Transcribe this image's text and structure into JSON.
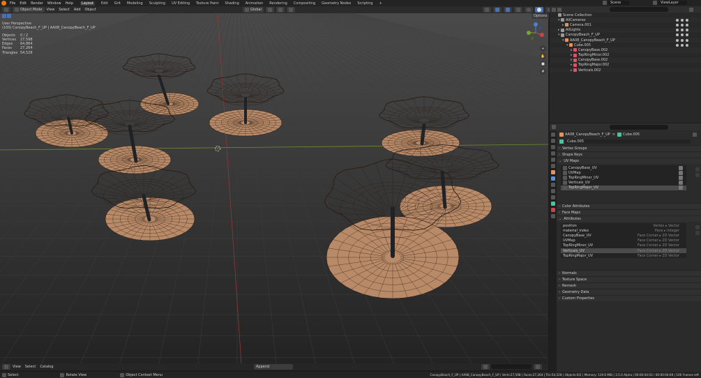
{
  "topbar": {
    "menus": [
      "File",
      "Edit",
      "Render",
      "Window",
      "Help"
    ],
    "workspaces": [
      "Layout",
      "Edit",
      "Grit",
      "Modeling",
      "Sculpting",
      "UV Editing",
      "Texture Paint",
      "Shading",
      "Animation",
      "Rendering",
      "Compositing",
      "Geometry Nodes",
      "Scripting"
    ],
    "active_workspace": "Layout",
    "plus": "+",
    "scene_label": "Scene",
    "viewlayer_label": "ViewLayer"
  },
  "viewport_header": {
    "mode": "Object Mode",
    "menus": [
      "View",
      "Select",
      "Add",
      "Object"
    ],
    "orientation": "Global",
    "options": "Options"
  },
  "viewport_info": {
    "view_name": "User Perspective",
    "context": "(100) CanopyBeach_F_UP | AA08_CanopyBeach_F_UP",
    "stats": [
      {
        "label": "Objects",
        "value": "0 / 2"
      },
      {
        "label": "Vertices",
        "value": "27,598"
      },
      {
        "label": "Edges",
        "value": "64,864"
      },
      {
        "label": "Faces",
        "value": "27,264"
      },
      {
        "label": "Triangles",
        "value": "54,528"
      }
    ]
  },
  "gizmo": {
    "x": "X",
    "y": "Y",
    "z": "Z"
  },
  "viewport_footer": {
    "menus": [
      "View",
      "Select",
      "Catalog"
    ],
    "append": "Append"
  },
  "outliner": {
    "title": "Scene Collection",
    "rows": [
      {
        "label": "AllCameras",
        "depth": 1,
        "color": "#9a9a9a",
        "expanded": true
      },
      {
        "label": "Camera.001",
        "depth": 2,
        "color": "#e2955a",
        "expanded": false
      },
      {
        "label": "AllLights",
        "depth": 1,
        "color": "#9a9a9a",
        "expanded": false
      },
      {
        "label": "CanopyBeach_F_UP",
        "depth": 1,
        "color": "#9a9a9a",
        "expanded": true
      },
      {
        "label": "AA08_CanopyBeach_F_UP",
        "depth": 2,
        "color": "#e2955a",
        "expanded": true
      },
      {
        "label": "Cube.005",
        "depth": 3,
        "color": "#e2955a",
        "expanded": true
      },
      {
        "label": "CanopyBase.002",
        "depth": 4,
        "color": "#d7566e",
        "expanded": false
      },
      {
        "label": "TopRingMinor.002",
        "depth": 4,
        "color": "#d7566e",
        "expanded": false
      },
      {
        "label": "CanopyBase.002",
        "depth": 4,
        "color": "#d7566e",
        "expanded": false
      },
      {
        "label": "TopRingMajor.002",
        "depth": 4,
        "color": "#d7566e",
        "expanded": false
      },
      {
        "label": "Verticals.002",
        "depth": 4,
        "color": "#d7566e",
        "expanded": false
      }
    ]
  },
  "properties": {
    "breadcrumb_object": "AA08_CanopyBeach_F_UP",
    "breadcrumb_sep": ">",
    "breadcrumb_mesh": "Cube.005",
    "mesh_name": "Cube.005",
    "panels_top": [
      "Vertex Groups",
      "Shape Keys"
    ],
    "uv_maps_title": "UV Maps",
    "uv_maps": [
      "CanopyBase_UV",
      "UVMap",
      "TopRingMinor_UV",
      "Verticals_UV",
      "TopRingMajor_UV"
    ],
    "uv_selected": 4,
    "panels_mid": [
      "Color Attributes",
      "Face Maps"
    ],
    "attributes_title": "Attributes",
    "attributes": [
      {
        "name": "position",
        "domain": "Vertex ▸ Vector"
      },
      {
        "name": "material_index",
        "domain": "Face ▸ Integer"
      },
      {
        "name": "CanopyBase_UV",
        "domain": "Face Corner ▸ 2D Vector"
      },
      {
        "name": "UVMap",
        "domain": "Face Corner ▸ 2D Vector"
      },
      {
        "name": "TopRingMinor_UV",
        "domain": "Face Corner ▸ 2D Vector"
      },
      {
        "name": "Verticals_UV",
        "domain": "Face Corner ▸ 2D Vector"
      },
      {
        "name": "TopRingMajor_UV",
        "domain": "Face Corner ▸ 2D Vector"
      }
    ],
    "attr_selected": 5,
    "panels_bottom": [
      "Normals",
      "Texture Space",
      "Remesh",
      "Geometry Data",
      "Custom Properties"
    ]
  },
  "statusbar": {
    "select": "Select",
    "rotate": "Rotate View",
    "context_menu": "Object Context Menu",
    "stats": "CanopyBeach_F_UP | AA08_CanopyBeach_F_UP | Verts:27,598 | Faces:27,264 | Tris:54,528 | Objects:0/2 | Memory: 119.6 MiB | 3.5.0 Alpha | 00:00:04:03 / 00:00:04:09 | 100 Frames left"
  },
  "colors": {
    "accent": "#4772b3",
    "canopy_fill": "#b88a68",
    "canopy_wire": "#2a1c14",
    "grid": "#3d3d3d",
    "x_axis": "#8b3a3a",
    "y_axis": "#6d8f2a"
  }
}
